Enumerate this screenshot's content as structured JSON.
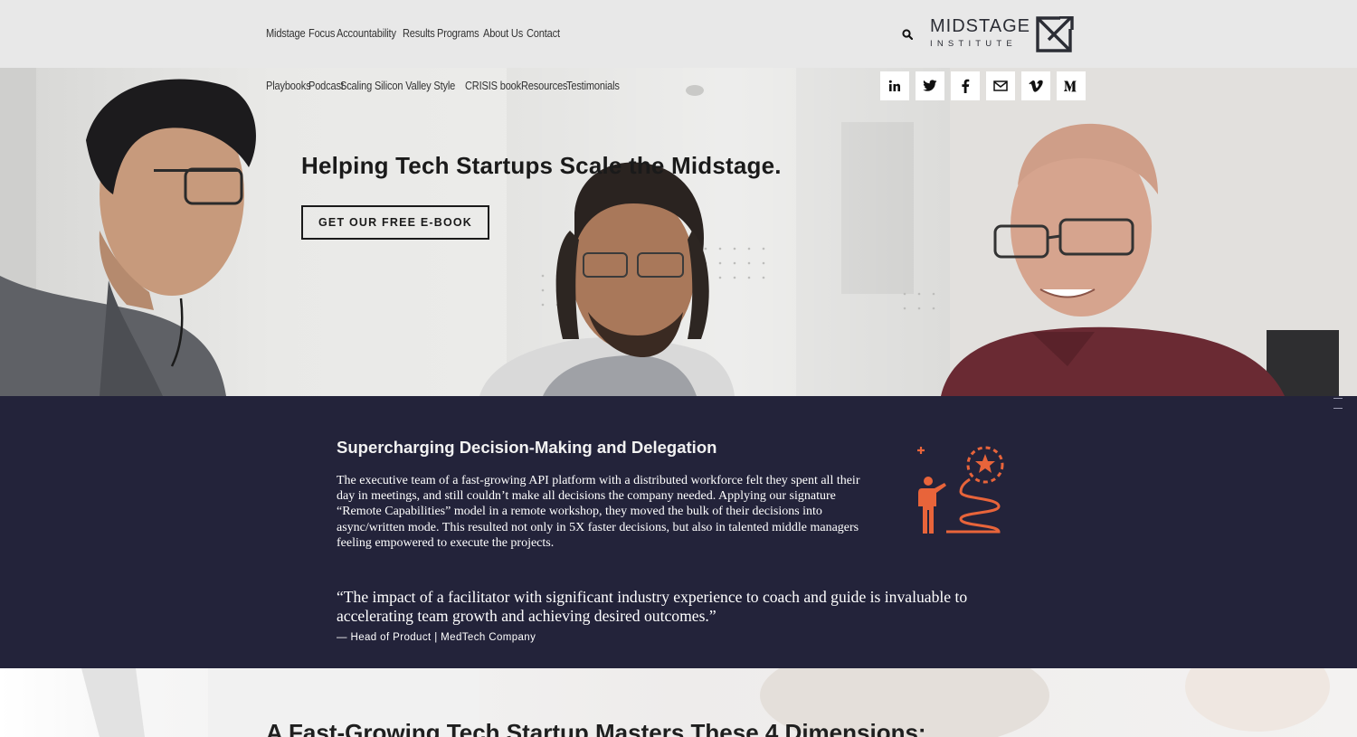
{
  "header": {
    "nav_primary": [
      "Midstage",
      "Focus",
      "Accountability",
      "Results",
      "Programs",
      "About Us",
      "Contact"
    ],
    "logo": {
      "main": "MIDSTAGE",
      "sub": "INSTITUTE"
    },
    "search_icon": "search-icon"
  },
  "hero": {
    "nav_secondary": [
      "Playbooks",
      "Podcast",
      "Scaling Silicon Valley Style",
      "CRISIS book",
      "Resources",
      "Testimonials"
    ],
    "social": [
      "linkedin-icon",
      "twitter-icon",
      "facebook-icon",
      "email-icon",
      "vimeo-icon",
      "medium-icon"
    ],
    "title": "Helping Tech Startups Scale the Midstage.",
    "cta_label": "GET OUR FREE E-BOOK"
  },
  "case_study": {
    "title": "Supercharging Decision-Making and Delegation",
    "body": "The executive team of a fast-growing API platform with a distributed workforce felt they spent all their day in meetings, and still couldn’t make all decisions the company needed. Applying our signature “Remote Capabilities” model in a remote workshop, they moved the bulk of their decisions into async/written mode. This resulted not only in 5X faster decisions, but also in talented middle managers feeling empowered to execute the projects.",
    "quote": "“The impact of a facilitator with significant industry experience to coach and guide is invaluable to accelerating team growth and achieving desired outcomes.”",
    "attribution": "— Head of Product | MedTech Company",
    "accent_color": "#e8643a",
    "background_color": "#23233a"
  },
  "lower": {
    "title": "A Fast-Growing Tech Startup Masters These 4 Dimensions:"
  }
}
